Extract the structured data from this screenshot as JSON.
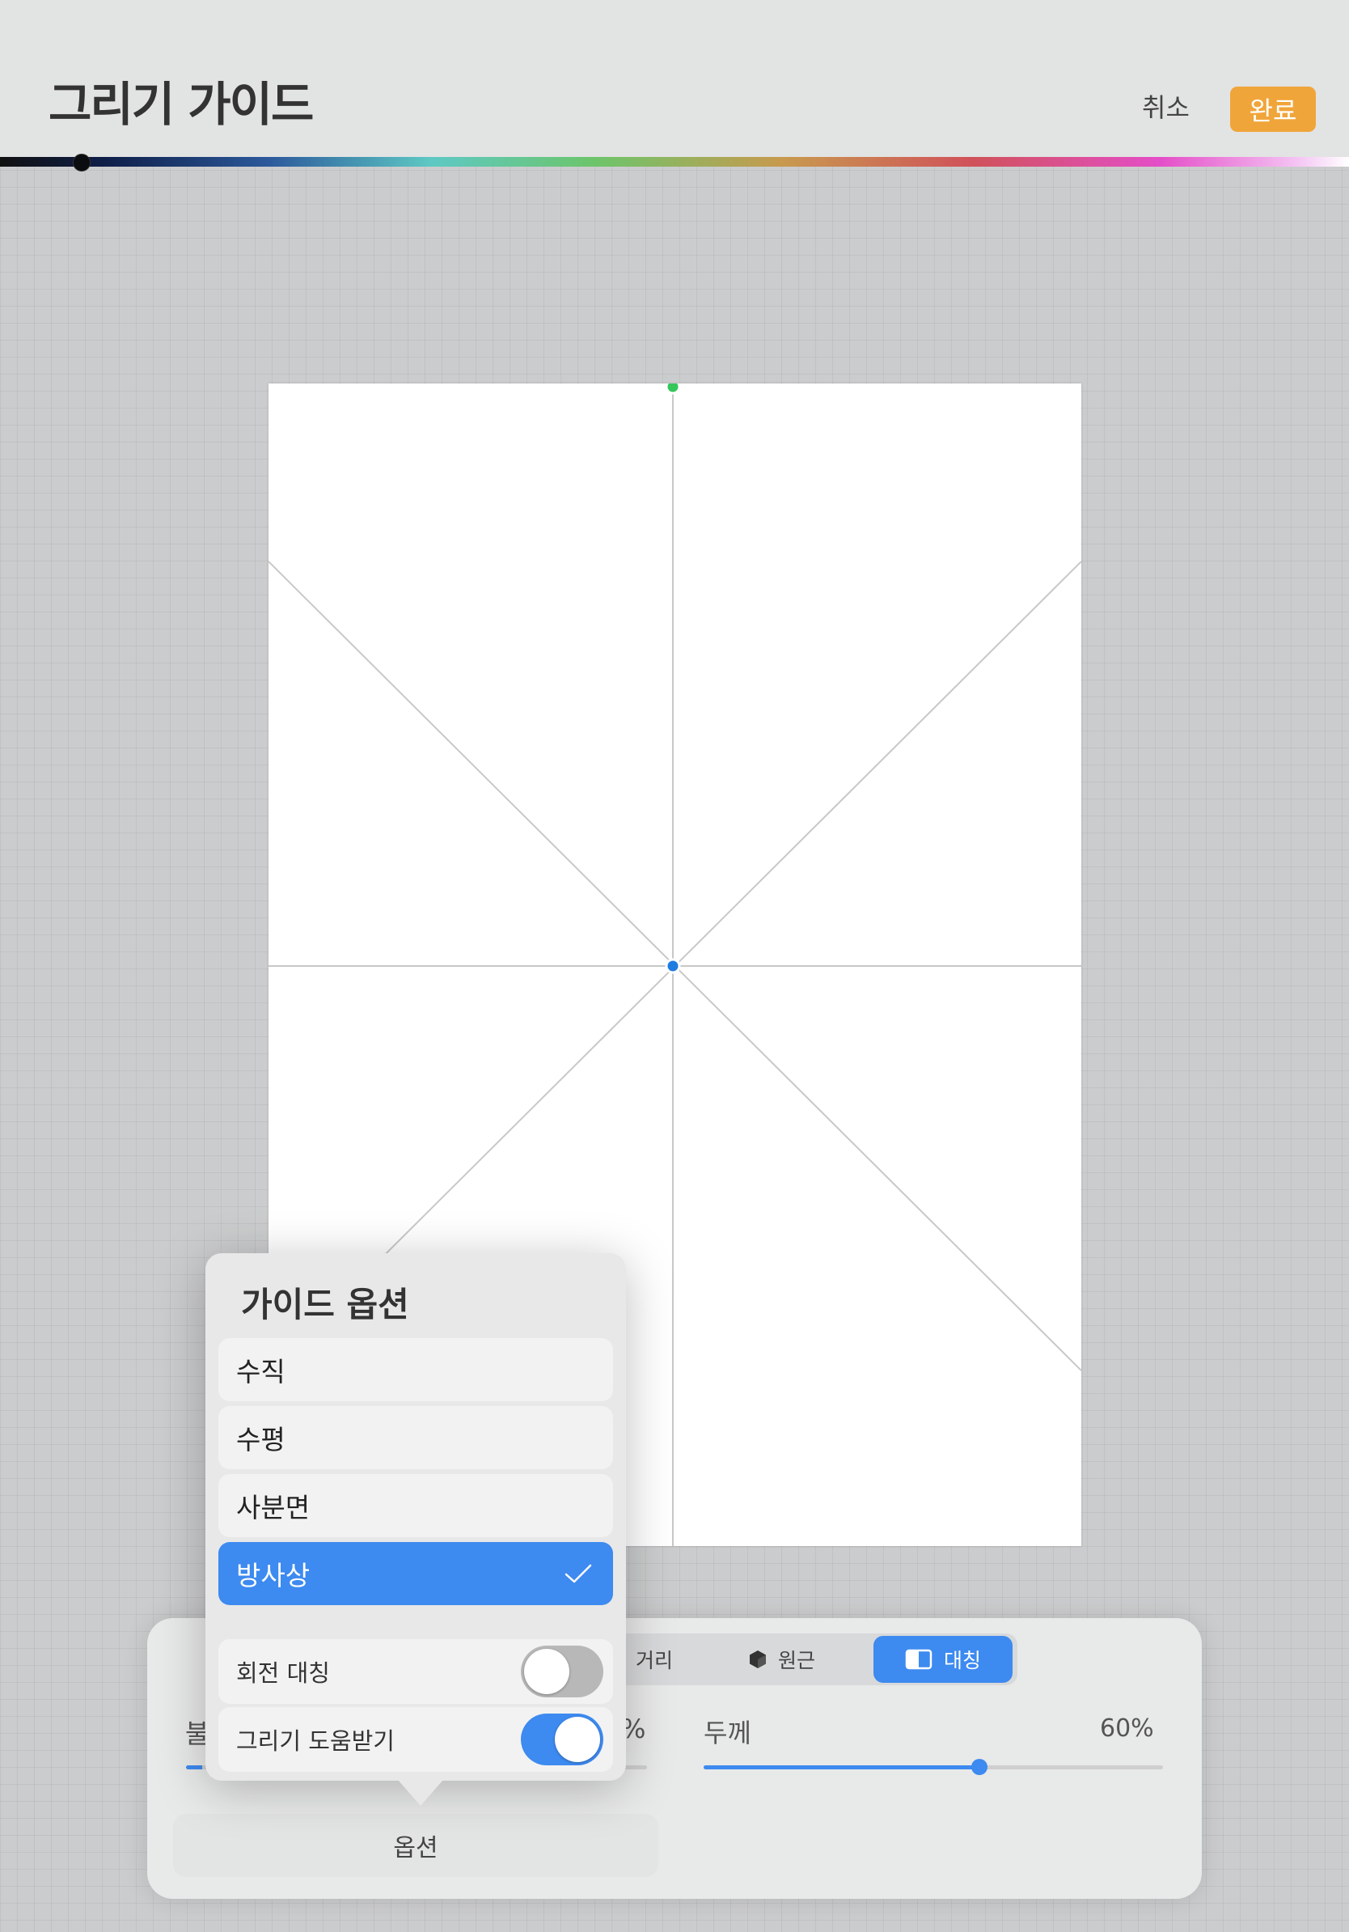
{
  "header": {
    "title": "그리기 가이드",
    "cancel_label": "취소",
    "done_label": "완료"
  },
  "colors": {
    "accent": "#3d8af0",
    "done_button": "#f0a53a",
    "center_handle": "#1e7be0",
    "top_handle": "#34c759"
  },
  "segments": {
    "distance": "거리",
    "perspective": "원근",
    "symmetry": "대칭",
    "selected": "symmetry"
  },
  "sliders": {
    "opacity_label": "불",
    "opacity_value_fragment": "%",
    "thickness_label": "두께",
    "thickness_value": "60%",
    "thickness_fraction": 0.6
  },
  "options_button_label": "옵션",
  "popover": {
    "title": "가이드 옵션",
    "options": [
      {
        "label": "수직",
        "selected": false
      },
      {
        "label": "수평",
        "selected": false
      },
      {
        "label": "사분면",
        "selected": false
      },
      {
        "label": "방사상",
        "selected": true
      }
    ],
    "toggles": [
      {
        "label": "회전 대칭",
        "on": false
      },
      {
        "label": "그리기 도움받기",
        "on": true
      }
    ]
  }
}
